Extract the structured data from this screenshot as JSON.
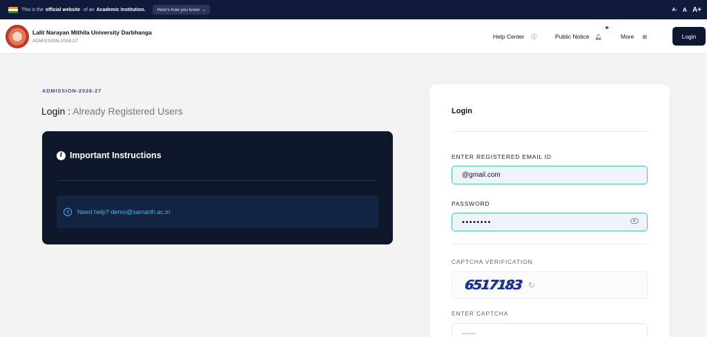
{
  "gov_bar": {
    "prefix": "This is the",
    "official": "official website",
    "of_an": "of an",
    "institution": "Academic Institution.",
    "know_button": "Here's how you know",
    "font_small": "A-",
    "font_normal": "A",
    "font_large": "A+"
  },
  "header": {
    "university": "Lalit Narayan Mithila University Darbhanga",
    "session": "ADMISSION-2026-27",
    "nav": {
      "help_center": "Help Center",
      "public_notice": "Public Notice",
      "more": "More"
    },
    "login_button": "Login"
  },
  "main": {
    "admission_label": "ADMISSION-2026-27",
    "title_main": "Login : ",
    "title_light": "Already Registered Users",
    "instructions": {
      "title": "Important Instructions",
      "help_text": "Need help? demo@samarth.ac.in"
    }
  },
  "login_form": {
    "title": "Login",
    "email_label": "ENTER REGISTERED EMAIL ID",
    "email_value": "@gmail.com",
    "password_label": "PASSWORD",
    "password_value": "••••••••",
    "captcha_label": "CAPTCHA VERIFICATION",
    "captcha_text": "6517183",
    "enter_captcha_label": "ENTER CAPTCHA",
    "captcha_placeholder": "------"
  },
  "colors": {
    "gov_bar_bg": "#0f1a3d",
    "primary_dark": "#0c1733",
    "accent_blue": "#2d4fb8",
    "input_border_active": "#4cc5a0",
    "help_cyan": "#3fb6e8"
  }
}
